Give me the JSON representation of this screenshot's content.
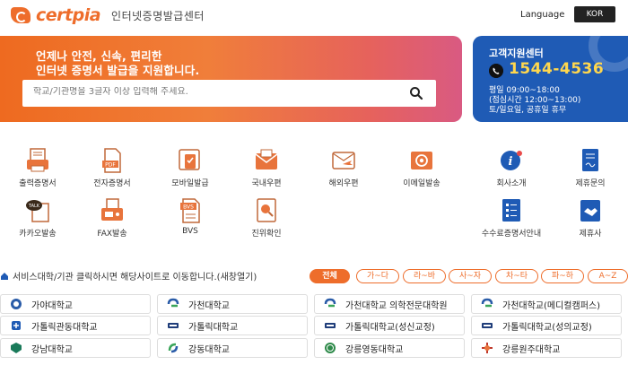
{
  "header": {
    "logo_text": "certpia",
    "logo_subtitle": "인터넷증명발급센터",
    "language_label": "Language",
    "language_value": "KOR"
  },
  "banner": {
    "line1": "언제나 안전, 신속, 편리한",
    "line2": "인터넷 증명서 발급을 지원합니다.",
    "search_placeholder": "학교/기관명을 3글자 이상 입력해 주세요."
  },
  "support": {
    "title": "고객지원센터",
    "phone": "1544-4536",
    "hours_weekday": "평일 09:00~18:00",
    "hours_lunch": "(점심시간 12:00~13:00)",
    "hours_weekend": "토/일요일, 공휴일 휴무"
  },
  "services": [
    {
      "label": "출력증명서",
      "icon": "printer-document-icon"
    },
    {
      "label": "전자증명서",
      "icon": "pdf-document-icon"
    },
    {
      "label": "모바일발급",
      "icon": "mobile-document-icon"
    },
    {
      "label": "국내우편",
      "icon": "envelope-icon"
    },
    {
      "label": "해외우편",
      "icon": "airmail-envelope-icon"
    },
    {
      "label": "이메일발송",
      "icon": "email-at-icon"
    },
    {
      "label": "회사소개",
      "icon": "info-icon"
    },
    {
      "label": "제휴문의",
      "icon": "contract-icon"
    },
    {
      "label": "카카오발송",
      "icon": "talk-bubble-icon"
    },
    {
      "label": "FAX발송",
      "icon": "fax-icon"
    },
    {
      "label": "BVS",
      "icon": "bvs-document-icon"
    },
    {
      "label": "진위확인",
      "icon": "verify-magnifier-icon"
    },
    {
      "label": "수수료증명서안내",
      "icon": "fee-list-icon"
    },
    {
      "label": "제휴사",
      "icon": "handshake-icon"
    }
  ],
  "filter": {
    "info": "서비스대학/기관 클릭하시면 해당사이트로 이동합니다.(새창열기)",
    "tabs": [
      "전체",
      "가~다",
      "라~바",
      "사~자",
      "차~타",
      "파~하",
      "A~Z"
    ]
  },
  "universities": [
    "가야대학교",
    "가천대학교",
    "가천대학교 의학전문대학원",
    "가천대학교(메디컬캠퍼스)",
    "가톨릭관동대학교",
    "가톨릭대학교",
    "가톨릭대학교(성신교정)",
    "가톨릭대학교(성의교정)",
    "강남대학교",
    "강동대학교",
    "강릉영동대학교",
    "강릉원주대학교"
  ],
  "colors": {
    "brand_orange": "#ee6d2b",
    "support_blue": "#1f5bb5",
    "phone_yellow": "#ffd74d"
  }
}
